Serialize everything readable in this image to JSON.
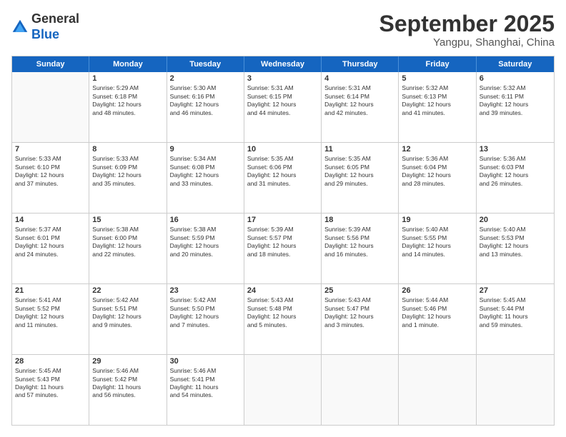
{
  "logo": {
    "general": "General",
    "blue": "Blue"
  },
  "header": {
    "month": "September 2025",
    "location": "Yangpu, Shanghai, China"
  },
  "days": [
    "Sunday",
    "Monday",
    "Tuesday",
    "Wednesday",
    "Thursday",
    "Friday",
    "Saturday"
  ],
  "rows": [
    [
      {
        "day": "",
        "lines": [],
        "empty": true
      },
      {
        "day": "1",
        "lines": [
          "Sunrise: 5:29 AM",
          "Sunset: 6:18 PM",
          "Daylight: 12 hours",
          "and 48 minutes."
        ]
      },
      {
        "day": "2",
        "lines": [
          "Sunrise: 5:30 AM",
          "Sunset: 6:16 PM",
          "Daylight: 12 hours",
          "and 46 minutes."
        ]
      },
      {
        "day": "3",
        "lines": [
          "Sunrise: 5:31 AM",
          "Sunset: 6:15 PM",
          "Daylight: 12 hours",
          "and 44 minutes."
        ]
      },
      {
        "day": "4",
        "lines": [
          "Sunrise: 5:31 AM",
          "Sunset: 6:14 PM",
          "Daylight: 12 hours",
          "and 42 minutes."
        ]
      },
      {
        "day": "5",
        "lines": [
          "Sunrise: 5:32 AM",
          "Sunset: 6:13 PM",
          "Daylight: 12 hours",
          "and 41 minutes."
        ]
      },
      {
        "day": "6",
        "lines": [
          "Sunrise: 5:32 AM",
          "Sunset: 6:11 PM",
          "Daylight: 12 hours",
          "and 39 minutes."
        ]
      }
    ],
    [
      {
        "day": "7",
        "lines": [
          "Sunrise: 5:33 AM",
          "Sunset: 6:10 PM",
          "Daylight: 12 hours",
          "and 37 minutes."
        ]
      },
      {
        "day": "8",
        "lines": [
          "Sunrise: 5:33 AM",
          "Sunset: 6:09 PM",
          "Daylight: 12 hours",
          "and 35 minutes."
        ]
      },
      {
        "day": "9",
        "lines": [
          "Sunrise: 5:34 AM",
          "Sunset: 6:08 PM",
          "Daylight: 12 hours",
          "and 33 minutes."
        ]
      },
      {
        "day": "10",
        "lines": [
          "Sunrise: 5:35 AM",
          "Sunset: 6:06 PM",
          "Daylight: 12 hours",
          "and 31 minutes."
        ]
      },
      {
        "day": "11",
        "lines": [
          "Sunrise: 5:35 AM",
          "Sunset: 6:05 PM",
          "Daylight: 12 hours",
          "and 29 minutes."
        ]
      },
      {
        "day": "12",
        "lines": [
          "Sunrise: 5:36 AM",
          "Sunset: 6:04 PM",
          "Daylight: 12 hours",
          "and 28 minutes."
        ]
      },
      {
        "day": "13",
        "lines": [
          "Sunrise: 5:36 AM",
          "Sunset: 6:03 PM",
          "Daylight: 12 hours",
          "and 26 minutes."
        ]
      }
    ],
    [
      {
        "day": "14",
        "lines": [
          "Sunrise: 5:37 AM",
          "Sunset: 6:01 PM",
          "Daylight: 12 hours",
          "and 24 minutes."
        ]
      },
      {
        "day": "15",
        "lines": [
          "Sunrise: 5:38 AM",
          "Sunset: 6:00 PM",
          "Daylight: 12 hours",
          "and 22 minutes."
        ]
      },
      {
        "day": "16",
        "lines": [
          "Sunrise: 5:38 AM",
          "Sunset: 5:59 PM",
          "Daylight: 12 hours",
          "and 20 minutes."
        ]
      },
      {
        "day": "17",
        "lines": [
          "Sunrise: 5:39 AM",
          "Sunset: 5:57 PM",
          "Daylight: 12 hours",
          "and 18 minutes."
        ]
      },
      {
        "day": "18",
        "lines": [
          "Sunrise: 5:39 AM",
          "Sunset: 5:56 PM",
          "Daylight: 12 hours",
          "and 16 minutes."
        ]
      },
      {
        "day": "19",
        "lines": [
          "Sunrise: 5:40 AM",
          "Sunset: 5:55 PM",
          "Daylight: 12 hours",
          "and 14 minutes."
        ]
      },
      {
        "day": "20",
        "lines": [
          "Sunrise: 5:40 AM",
          "Sunset: 5:53 PM",
          "Daylight: 12 hours",
          "and 13 minutes."
        ]
      }
    ],
    [
      {
        "day": "21",
        "lines": [
          "Sunrise: 5:41 AM",
          "Sunset: 5:52 PM",
          "Daylight: 12 hours",
          "and 11 minutes."
        ]
      },
      {
        "day": "22",
        "lines": [
          "Sunrise: 5:42 AM",
          "Sunset: 5:51 PM",
          "Daylight: 12 hours",
          "and 9 minutes."
        ]
      },
      {
        "day": "23",
        "lines": [
          "Sunrise: 5:42 AM",
          "Sunset: 5:50 PM",
          "Daylight: 12 hours",
          "and 7 minutes."
        ]
      },
      {
        "day": "24",
        "lines": [
          "Sunrise: 5:43 AM",
          "Sunset: 5:48 PM",
          "Daylight: 12 hours",
          "and 5 minutes."
        ]
      },
      {
        "day": "25",
        "lines": [
          "Sunrise: 5:43 AM",
          "Sunset: 5:47 PM",
          "Daylight: 12 hours",
          "and 3 minutes."
        ]
      },
      {
        "day": "26",
        "lines": [
          "Sunrise: 5:44 AM",
          "Sunset: 5:46 PM",
          "Daylight: 12 hours",
          "and 1 minute."
        ]
      },
      {
        "day": "27",
        "lines": [
          "Sunrise: 5:45 AM",
          "Sunset: 5:44 PM",
          "Daylight: 11 hours",
          "and 59 minutes."
        ]
      }
    ],
    [
      {
        "day": "28",
        "lines": [
          "Sunrise: 5:45 AM",
          "Sunset: 5:43 PM",
          "Daylight: 11 hours",
          "and 57 minutes."
        ]
      },
      {
        "day": "29",
        "lines": [
          "Sunrise: 5:46 AM",
          "Sunset: 5:42 PM",
          "Daylight: 11 hours",
          "and 56 minutes."
        ]
      },
      {
        "day": "30",
        "lines": [
          "Sunrise: 5:46 AM",
          "Sunset: 5:41 PM",
          "Daylight: 11 hours",
          "and 54 minutes."
        ]
      },
      {
        "day": "",
        "lines": [],
        "empty": true
      },
      {
        "day": "",
        "lines": [],
        "empty": true
      },
      {
        "day": "",
        "lines": [],
        "empty": true
      },
      {
        "day": "",
        "lines": [],
        "empty": true
      }
    ]
  ]
}
